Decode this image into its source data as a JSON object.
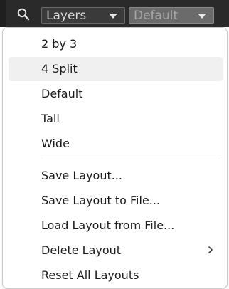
{
  "toolbar": {
    "search_icon": "search-icon",
    "layers_dropdown": {
      "label": "Layers",
      "caret_icon": "caret-down-icon"
    },
    "layout_dropdown": {
      "label": "Default",
      "caret_icon": "caret-down-icon"
    }
  },
  "menu": {
    "group1": [
      {
        "label": "2 by 3"
      },
      {
        "label": "4 Split"
      },
      {
        "label": "Default"
      },
      {
        "label": "Tall"
      },
      {
        "label": "Wide"
      }
    ],
    "group2": [
      {
        "label": "Save Layout..."
      },
      {
        "label": "Save Layout to File..."
      },
      {
        "label": "Load Layout from File..."
      },
      {
        "label": "Delete Layout"
      },
      {
        "label": "Reset All Layouts"
      }
    ],
    "submenu_icon": "chevron-right-icon",
    "highlighted_item": "4 Split"
  },
  "colors": {
    "toolbar_bg": "#2a2a2a",
    "menu_bg": "#ffffff",
    "highlight_bg": "#f0f0f0",
    "text": "#1b1b1b"
  }
}
